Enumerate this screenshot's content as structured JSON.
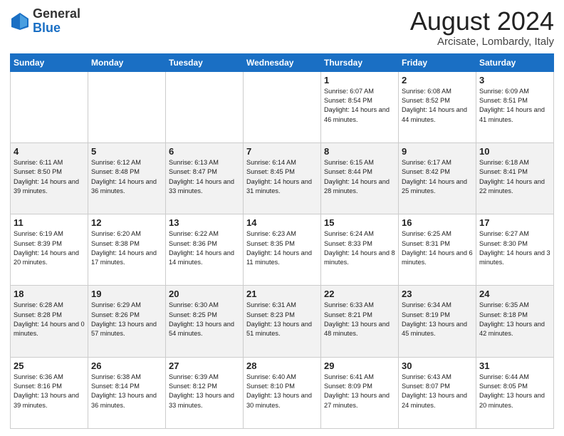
{
  "logo": {
    "general": "General",
    "blue": "Blue"
  },
  "header": {
    "month_year": "August 2024",
    "location": "Arcisate, Lombardy, Italy"
  },
  "days_of_week": [
    "Sunday",
    "Monday",
    "Tuesday",
    "Wednesday",
    "Thursday",
    "Friday",
    "Saturday"
  ],
  "weeks": [
    [
      {
        "day": "",
        "info": ""
      },
      {
        "day": "",
        "info": ""
      },
      {
        "day": "",
        "info": ""
      },
      {
        "day": "",
        "info": ""
      },
      {
        "day": "1",
        "info": "Sunrise: 6:07 AM\nSunset: 8:54 PM\nDaylight: 14 hours and 46 minutes."
      },
      {
        "day": "2",
        "info": "Sunrise: 6:08 AM\nSunset: 8:52 PM\nDaylight: 14 hours and 44 minutes."
      },
      {
        "day": "3",
        "info": "Sunrise: 6:09 AM\nSunset: 8:51 PM\nDaylight: 14 hours and 41 minutes."
      }
    ],
    [
      {
        "day": "4",
        "info": "Sunrise: 6:11 AM\nSunset: 8:50 PM\nDaylight: 14 hours and 39 minutes."
      },
      {
        "day": "5",
        "info": "Sunrise: 6:12 AM\nSunset: 8:48 PM\nDaylight: 14 hours and 36 minutes."
      },
      {
        "day": "6",
        "info": "Sunrise: 6:13 AM\nSunset: 8:47 PM\nDaylight: 14 hours and 33 minutes."
      },
      {
        "day": "7",
        "info": "Sunrise: 6:14 AM\nSunset: 8:45 PM\nDaylight: 14 hours and 31 minutes."
      },
      {
        "day": "8",
        "info": "Sunrise: 6:15 AM\nSunset: 8:44 PM\nDaylight: 14 hours and 28 minutes."
      },
      {
        "day": "9",
        "info": "Sunrise: 6:17 AM\nSunset: 8:42 PM\nDaylight: 14 hours and 25 minutes."
      },
      {
        "day": "10",
        "info": "Sunrise: 6:18 AM\nSunset: 8:41 PM\nDaylight: 14 hours and 22 minutes."
      }
    ],
    [
      {
        "day": "11",
        "info": "Sunrise: 6:19 AM\nSunset: 8:39 PM\nDaylight: 14 hours and 20 minutes."
      },
      {
        "day": "12",
        "info": "Sunrise: 6:20 AM\nSunset: 8:38 PM\nDaylight: 14 hours and 17 minutes."
      },
      {
        "day": "13",
        "info": "Sunrise: 6:22 AM\nSunset: 8:36 PM\nDaylight: 14 hours and 14 minutes."
      },
      {
        "day": "14",
        "info": "Sunrise: 6:23 AM\nSunset: 8:35 PM\nDaylight: 14 hours and 11 minutes."
      },
      {
        "day": "15",
        "info": "Sunrise: 6:24 AM\nSunset: 8:33 PM\nDaylight: 14 hours and 8 minutes."
      },
      {
        "day": "16",
        "info": "Sunrise: 6:25 AM\nSunset: 8:31 PM\nDaylight: 14 hours and 6 minutes."
      },
      {
        "day": "17",
        "info": "Sunrise: 6:27 AM\nSunset: 8:30 PM\nDaylight: 14 hours and 3 minutes."
      }
    ],
    [
      {
        "day": "18",
        "info": "Sunrise: 6:28 AM\nSunset: 8:28 PM\nDaylight: 14 hours and 0 minutes."
      },
      {
        "day": "19",
        "info": "Sunrise: 6:29 AM\nSunset: 8:26 PM\nDaylight: 13 hours and 57 minutes."
      },
      {
        "day": "20",
        "info": "Sunrise: 6:30 AM\nSunset: 8:25 PM\nDaylight: 13 hours and 54 minutes."
      },
      {
        "day": "21",
        "info": "Sunrise: 6:31 AM\nSunset: 8:23 PM\nDaylight: 13 hours and 51 minutes."
      },
      {
        "day": "22",
        "info": "Sunrise: 6:33 AM\nSunset: 8:21 PM\nDaylight: 13 hours and 48 minutes."
      },
      {
        "day": "23",
        "info": "Sunrise: 6:34 AM\nSunset: 8:19 PM\nDaylight: 13 hours and 45 minutes."
      },
      {
        "day": "24",
        "info": "Sunrise: 6:35 AM\nSunset: 8:18 PM\nDaylight: 13 hours and 42 minutes."
      }
    ],
    [
      {
        "day": "25",
        "info": "Sunrise: 6:36 AM\nSunset: 8:16 PM\nDaylight: 13 hours and 39 minutes."
      },
      {
        "day": "26",
        "info": "Sunrise: 6:38 AM\nSunset: 8:14 PM\nDaylight: 13 hours and 36 minutes."
      },
      {
        "day": "27",
        "info": "Sunrise: 6:39 AM\nSunset: 8:12 PM\nDaylight: 13 hours and 33 minutes."
      },
      {
        "day": "28",
        "info": "Sunrise: 6:40 AM\nSunset: 8:10 PM\nDaylight: 13 hours and 30 minutes."
      },
      {
        "day": "29",
        "info": "Sunrise: 6:41 AM\nSunset: 8:09 PM\nDaylight: 13 hours and 27 minutes."
      },
      {
        "day": "30",
        "info": "Sunrise: 6:43 AM\nSunset: 8:07 PM\nDaylight: 13 hours and 24 minutes."
      },
      {
        "day": "31",
        "info": "Sunrise: 6:44 AM\nSunset: 8:05 PM\nDaylight: 13 hours and 20 minutes."
      }
    ]
  ]
}
